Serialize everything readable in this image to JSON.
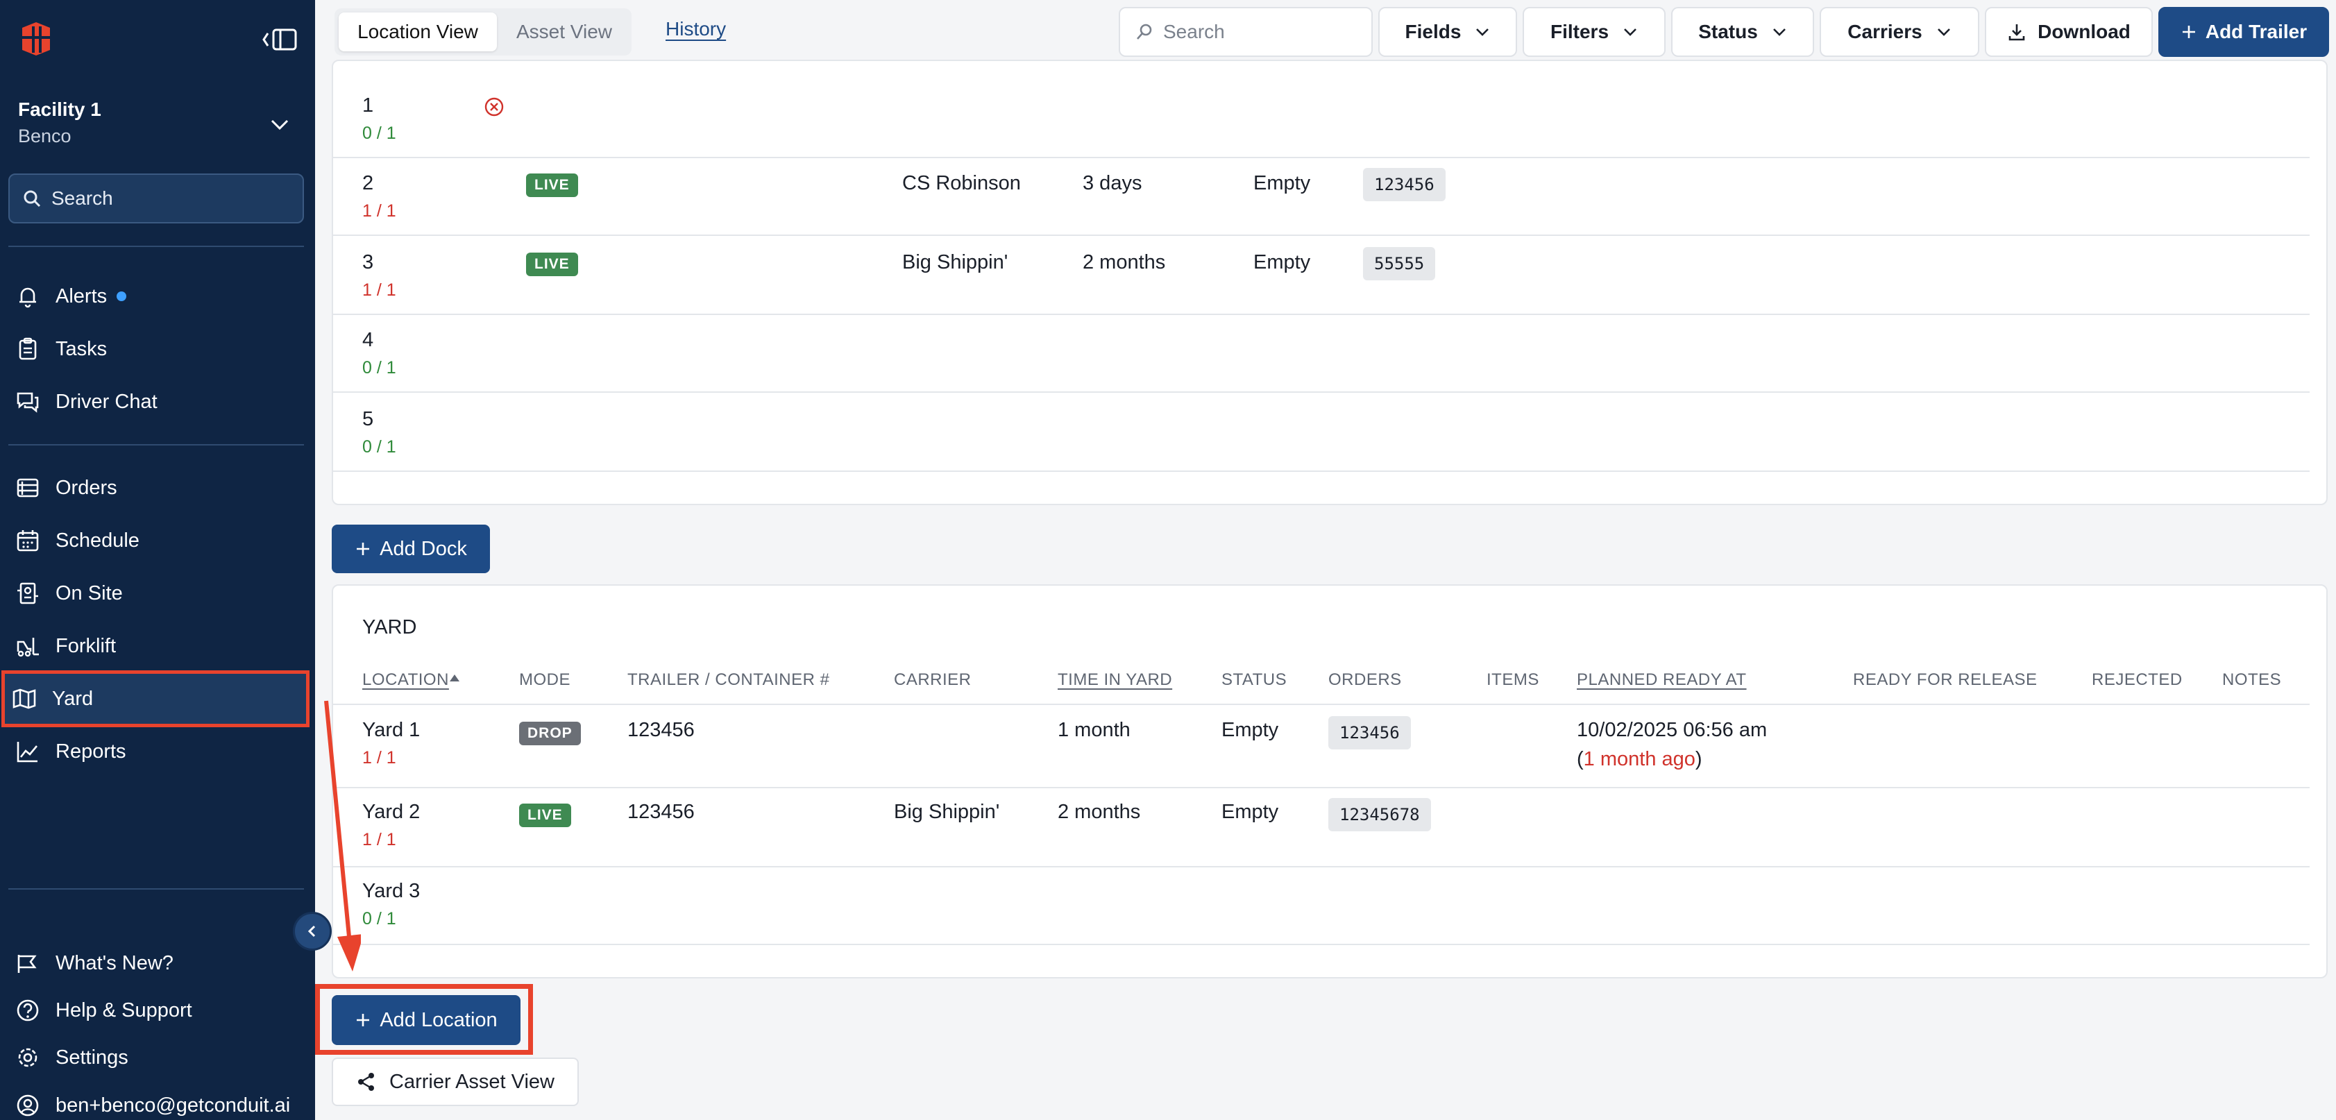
{
  "sidebar": {
    "facility_name": "Facility 1",
    "facility_org": "Benco",
    "search_label": "Search",
    "items": {
      "alerts": "Alerts",
      "tasks": "Tasks",
      "driver_chat": "Driver Chat",
      "orders": "Orders",
      "schedule": "Schedule",
      "on_site": "On Site",
      "forklift": "Forklift",
      "yard": "Yard",
      "reports": "Reports",
      "whats_new": "What's New?",
      "help": "Help & Support",
      "settings": "Settings",
      "user": "ben+benco@getconduit.ai"
    },
    "active_item": "Yard"
  },
  "toolbar": {
    "location_view": "Location View",
    "asset_view": "Asset View",
    "history": "History",
    "search_placeholder": "Search",
    "fields": "Fields",
    "filters": "Filters",
    "status": "Status",
    "carriers": "Carriers",
    "download": "Download",
    "add_trailer": "Add Trailer"
  },
  "docks": {
    "rows": [
      {
        "location": "1",
        "count": "0 / 1",
        "count_color": "green",
        "mode": "",
        "carrier": "",
        "time": "",
        "status": "",
        "order": "",
        "icon": "circle-x-icon"
      },
      {
        "location": "2",
        "count": "1 / 1",
        "count_color": "red",
        "mode": "LIVE",
        "carrier": "CS Robinson",
        "time": "3 days",
        "status": "Empty",
        "order": "123456"
      },
      {
        "location": "3",
        "count": "1 / 1",
        "count_color": "red",
        "mode": "LIVE",
        "carrier": "Big Shippin'",
        "time": "2 months",
        "status": "Empty",
        "order": "55555"
      },
      {
        "location": "4",
        "count": "0 / 1",
        "count_color": "green"
      },
      {
        "location": "5",
        "count": "0 / 1",
        "count_color": "green"
      }
    ],
    "add_button": "Add Dock"
  },
  "yard": {
    "title": "YARD",
    "columns": {
      "location": "LOCATION",
      "mode": "MODE",
      "trailer": "TRAILER / CONTAINER #",
      "carrier": "CARRIER",
      "time_in_yard": "TIME IN YARD",
      "status": "STATUS",
      "orders": "ORDERS",
      "items": "ITEMS",
      "planned_ready_at": "PLANNED READY AT",
      "ready_for_release": "READY FOR RELEASE",
      "rejected": "REJECTED",
      "notes": "NOTES"
    },
    "rows": [
      {
        "location": "Yard 1",
        "count": "1 / 1",
        "mode": "DROP",
        "trailer": "123456",
        "carrier": "",
        "time": "1 month",
        "status": "Empty",
        "order": "123456",
        "planned": "10/02/2025 06:56 am",
        "planned_rel_open": "(",
        "planned_rel": "1 month ago",
        "planned_rel_close": ")"
      },
      {
        "location": "Yard 2",
        "count": "1 / 1",
        "mode": "LIVE",
        "trailer": "123456",
        "carrier": "Big Shippin'",
        "time": "2 months",
        "status": "Empty",
        "order": "12345678"
      },
      {
        "location": "Yard 3",
        "count": "0 / 1"
      }
    ],
    "add_button": "Add Location",
    "carrier_asset_view": "Carrier Asset View"
  },
  "colors": {
    "sidebar_bg": "#0f2544",
    "primary": "#1e4b86",
    "annotation_red": "#e8432d",
    "live_green": "#3f8a52",
    "drop_gray": "#6b6f76"
  }
}
